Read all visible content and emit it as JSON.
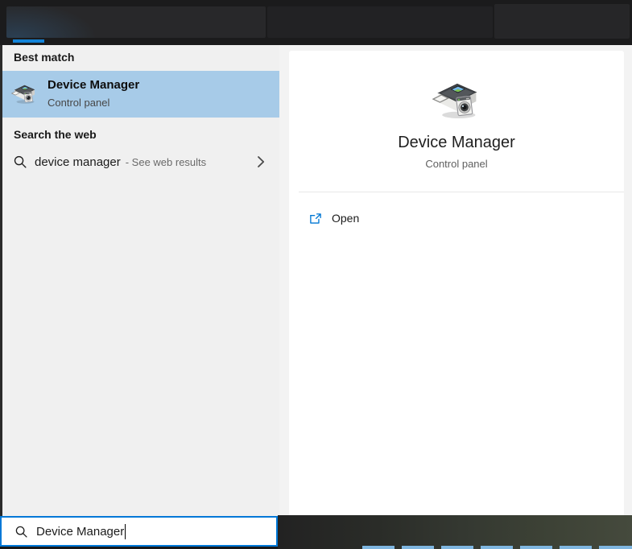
{
  "colors": {
    "accent_blue": "#0078d7",
    "selection_blue": "#a7cbe8",
    "tab_indicator_blue": "#1283d8",
    "taskbar_highlight_blue": "#7fb6e0",
    "panel_gray": "#f0f0f0",
    "topbar_dark": "#1b1b1c"
  },
  "best_match": {
    "header": "Best match",
    "title": "Device Manager",
    "subtitle": "Control panel",
    "icon": "device-manager-icon"
  },
  "web_search": {
    "header": "Search the web",
    "query": "device manager",
    "suffix": "- See web results",
    "icon": "search-icon",
    "chevron": "chevron-right-icon"
  },
  "preview": {
    "title": "Device Manager",
    "subtitle": "Control panel",
    "icon": "device-manager-icon",
    "actions": [
      {
        "label": "Open",
        "icon": "open-external-icon"
      }
    ]
  },
  "search_box": {
    "value": "Device Manager",
    "placeholder": "",
    "icon": "search-icon"
  }
}
